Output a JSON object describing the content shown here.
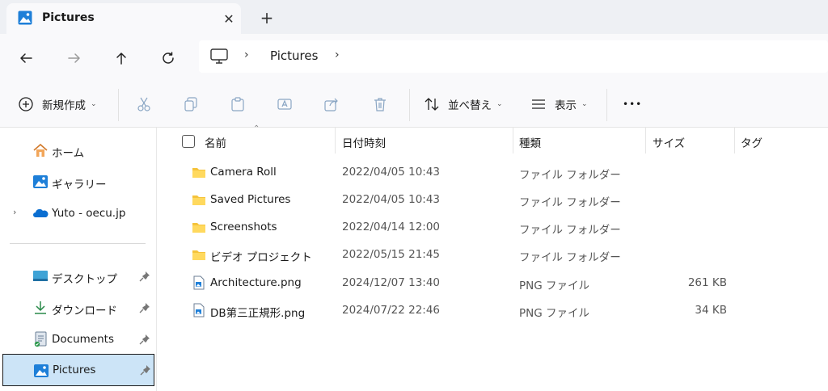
{
  "colors": {
    "accent": "#0067c0",
    "folder": "#f5c33b",
    "selection": "#cce4f7"
  },
  "tab": {
    "title": "Pictures",
    "close_glyph": "✕",
    "new_tab_glyph": "+"
  },
  "address": {
    "separator": "›",
    "crumb": "Pictures"
  },
  "commands": {
    "new_label": "新規作成",
    "sort_label": "並べ替え",
    "view_label": "表示",
    "more_glyph": "•••",
    "chevron": "⌄"
  },
  "sidebar": {
    "expand_glyph": "›",
    "items": [
      {
        "label": "ホーム",
        "icon": "home-icon"
      },
      {
        "label": "ギャラリー",
        "icon": "gallery-icon"
      },
      {
        "label": "Yuto - oecu.jp",
        "icon": "onedrive-icon"
      },
      {
        "label": "デスクトップ",
        "icon": "desktop-icon"
      },
      {
        "label": "ダウンロード",
        "icon": "download-icon"
      },
      {
        "label": "Documents",
        "icon": "documents-icon"
      },
      {
        "label": "Pictures",
        "icon": "pictures-icon"
      }
    ]
  },
  "columns": {
    "name": "名前",
    "date": "日付時刻",
    "type": "種類",
    "size": "サイズ",
    "tag": "タグ",
    "sort_glyph": "⌃"
  },
  "files": [
    {
      "name": "Camera Roll",
      "date": "2022/04/05 10:43",
      "type": "ファイル フォルダー",
      "size": "",
      "kind": "folder"
    },
    {
      "name": "Saved Pictures",
      "date": "2022/04/05 10:43",
      "type": "ファイル フォルダー",
      "size": "",
      "kind": "folder"
    },
    {
      "name": "Screenshots",
      "date": "2022/04/14 12:00",
      "type": "ファイル フォルダー",
      "size": "",
      "kind": "folder"
    },
    {
      "name": "ビデオ プロジェクト",
      "date": "2022/05/15 21:45",
      "type": "ファイル フォルダー",
      "size": "",
      "kind": "folder"
    },
    {
      "name": "Architecture.png",
      "date": "2024/12/07 13:40",
      "type": "PNG ファイル",
      "size": "261 KB",
      "kind": "png"
    },
    {
      "name": "DB第三正規形.png",
      "date": "2024/07/22 22:46",
      "type": "PNG ファイル",
      "size": "34 KB",
      "kind": "png"
    }
  ]
}
